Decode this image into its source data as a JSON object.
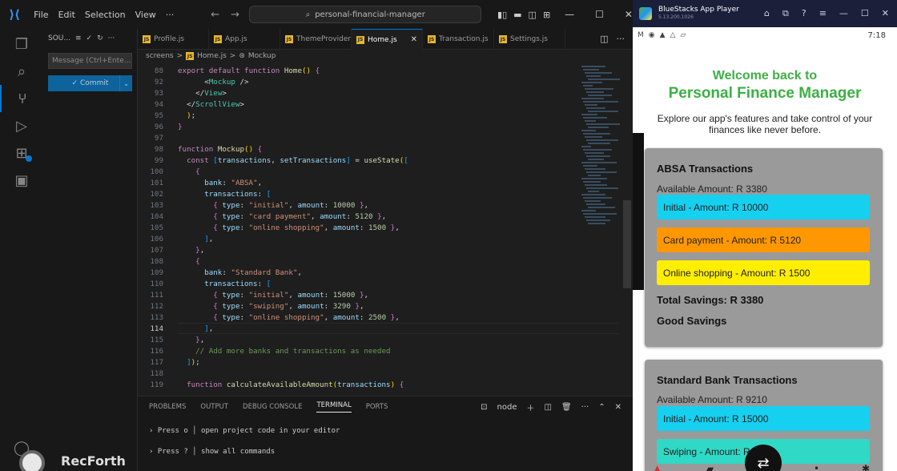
{
  "vscode": {
    "menu": [
      "File",
      "Edit",
      "Selection",
      "View",
      "···"
    ],
    "search": "personal-financial-manager",
    "sidebar": {
      "header": "SOU...",
      "message_placeholder": "Message (Ctrl+Ente...",
      "commit_label": "✓ Commit"
    },
    "tabs": [
      {
        "label": "Profile.js",
        "active": false
      },
      {
        "label": "App.js",
        "active": false
      },
      {
        "label": "ThemeProvider.js",
        "active": false
      },
      {
        "label": "Home.js",
        "active": true
      },
      {
        "label": "Transaction.js",
        "active": false
      },
      {
        "label": "Settings.js",
        "active": false
      }
    ],
    "breadcrumb": [
      "screens",
      ">",
      "Home.js",
      ">",
      "Mockup"
    ],
    "code": [
      {
        "n": "88",
        "t": "export default function Home() {"
      },
      {
        "n": "92",
        "t": "      <Mockup />"
      },
      {
        "n": "93",
        "t": "    </View>"
      },
      {
        "n": "94",
        "t": "  </ScrollView>"
      },
      {
        "n": "95",
        "t": "  );"
      },
      {
        "n": "96",
        "t": "}"
      },
      {
        "n": "97",
        "t": ""
      },
      {
        "n": "98",
        "t": "function Mockup() {"
      },
      {
        "n": "99",
        "t": "  const [transactions, setTransactions] = useState(["
      },
      {
        "n": "100",
        "t": "    {"
      },
      {
        "n": "101",
        "t": "      bank: \"ABSA\","
      },
      {
        "n": "102",
        "t": "      transactions: ["
      },
      {
        "n": "103",
        "t": "        { type: \"initial\", amount: 10000 },"
      },
      {
        "n": "104",
        "t": "        { type: \"card payment\", amount: 5120 },"
      },
      {
        "n": "105",
        "t": "        { type: \"online shopping\", amount: 1500 },"
      },
      {
        "n": "106",
        "t": "      ],"
      },
      {
        "n": "107",
        "t": "    },"
      },
      {
        "n": "108",
        "t": "    {"
      },
      {
        "n": "109",
        "t": "      bank: \"Standard Bank\","
      },
      {
        "n": "110",
        "t": "      transactions: ["
      },
      {
        "n": "111",
        "t": "        { type: \"initial\", amount: 15000 },"
      },
      {
        "n": "112",
        "t": "        { type: \"swiping\", amount: 3290 },"
      },
      {
        "n": "113",
        "t": "        { type: \"online shopping\", amount: 2500 },"
      },
      {
        "n": "114",
        "t": "      ],"
      },
      {
        "n": "115",
        "t": "    },"
      },
      {
        "n": "116",
        "t": "    // Add more banks and transactions as needed"
      },
      {
        "n": "117",
        "t": "  ]);"
      },
      {
        "n": "118",
        "t": ""
      },
      {
        "n": "119",
        "t": "  function calculateAvailableAmount(transactions) {"
      }
    ],
    "panel": {
      "tabs": [
        "PROBLEMS",
        "OUTPUT",
        "DEBUG CONSOLE",
        "TERMINAL",
        "PORTS"
      ],
      "active_tab": "TERMINAL",
      "shell": "node",
      "lines": [
        "› Press o │ open project code in your editor",
        "› Press ? │ show all commands"
      ]
    },
    "watermark": "RecForth"
  },
  "bluestacks": {
    "title": "BlueStacks App Player",
    "subtitle": "5.13.200.1026",
    "time": "7:18",
    "app": {
      "welcome": "Welcome back to",
      "name": "Personal Finance Manager",
      "intro": "Explore our app's features and take control of your finances like never before.",
      "cards": [
        {
          "title": "ABSA Transactions",
          "available": "Available Amount: R 3380",
          "transactions": [
            {
              "label": "Initial - Amount: R 10000",
              "color": "#16d0f0"
            },
            {
              "label": "Card payment - Amount: R 5120",
              "color": "#ff9800"
            },
            {
              "label": "Online shopping - Amount: R 1500",
              "color": "#ffee00"
            }
          ],
          "savings": "Total Savings: R 3380",
          "status": "Good Savings"
        },
        {
          "title": "Standard Bank Transactions",
          "available": "Available Amount: R 9210",
          "transactions": [
            {
              "label": "Initial - Amount: R 15000",
              "color": "#16d0f0"
            },
            {
              "label": "Swiping - Amount: R",
              "color": "#2fd9c5"
            }
          ]
        }
      ]
    }
  }
}
